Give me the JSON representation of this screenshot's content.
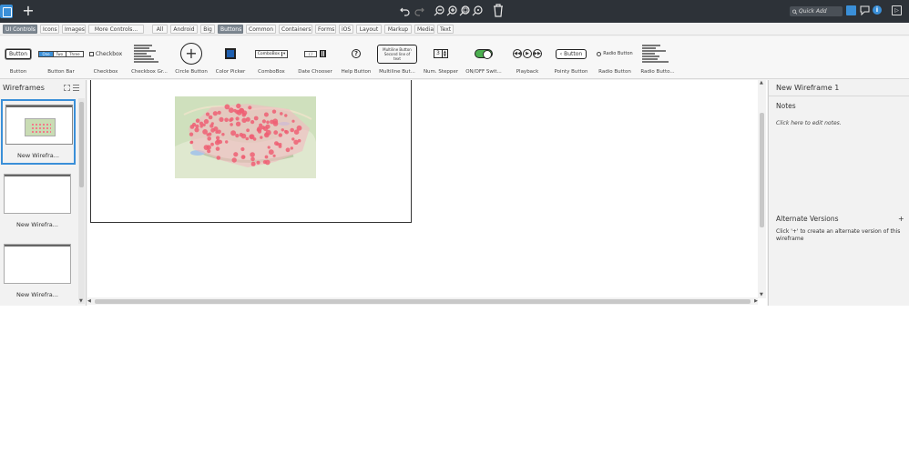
{
  "toolbar": {
    "quick_add_placeholder": "Quick Add",
    "add_symbol": "+",
    "info_symbol": "i"
  },
  "filter_tabs": [
    {
      "label": "UI Controls",
      "active": true
    },
    {
      "label": "Icons"
    },
    {
      "label": "Images"
    },
    {
      "label": "More Controls..."
    },
    {
      "label": "All"
    },
    {
      "label": "Android"
    },
    {
      "label": "Big"
    },
    {
      "label": "Buttons",
      "active": true
    },
    {
      "label": "Common"
    },
    {
      "label": "Containers"
    },
    {
      "label": "Forms"
    },
    {
      "label": "iOS"
    },
    {
      "label": "Layout"
    },
    {
      "label": "Markup"
    },
    {
      "label": "Media"
    },
    {
      "label": "Text"
    }
  ],
  "library": {
    "items": [
      {
        "label": "Button",
        "preview_text": "Button"
      },
      {
        "label": "Button Bar",
        "preview_parts": [
          "One",
          "Two",
          "Three"
        ]
      },
      {
        "label": "Checkbox",
        "preview_text": "Checkbox"
      },
      {
        "label": "Checkbox Gr..."
      },
      {
        "label": "Circle Button",
        "preview_text": "+"
      },
      {
        "label": "Color Picker"
      },
      {
        "label": "ComboBox",
        "preview_text": "ComboBox"
      },
      {
        "label": "Date Chooser",
        "preview_text": "/ /"
      },
      {
        "label": "Help Button",
        "preview_text": "?"
      },
      {
        "label": "Multiline But...",
        "preview_line1": "Multiline Button",
        "preview_line2": "Second line of text"
      },
      {
        "label": "Num. Stepper",
        "preview_text": "3"
      },
      {
        "label": "ON/OFF Swit..."
      },
      {
        "label": "Playback"
      },
      {
        "label": "Pointy Button",
        "preview_text": "Button"
      },
      {
        "label": "Radio Button",
        "preview_text": "Radio Button"
      },
      {
        "label": "Radio Butto..."
      }
    ]
  },
  "wireframes_panel": {
    "title": "Wireframes",
    "items": [
      {
        "caption": "New Wirefra...",
        "selected": true
      },
      {
        "caption": "New Wirefra..."
      },
      {
        "caption": "New Wirefra..."
      }
    ]
  },
  "right_panel": {
    "wireframe_name": "New Wireframe 1",
    "notes_title": "Notes",
    "notes_hint": "Click here to edit notes.",
    "alternate_title": "Alternate Versions",
    "alternate_add": "+",
    "alternate_text": "Click '+' to create an alternate version of this wireframe"
  },
  "colors": {
    "topbar": "#2d3238",
    "accent": "#3a8fd8",
    "active_tab": "#7d8791",
    "map_marker": "#f27a8a"
  }
}
